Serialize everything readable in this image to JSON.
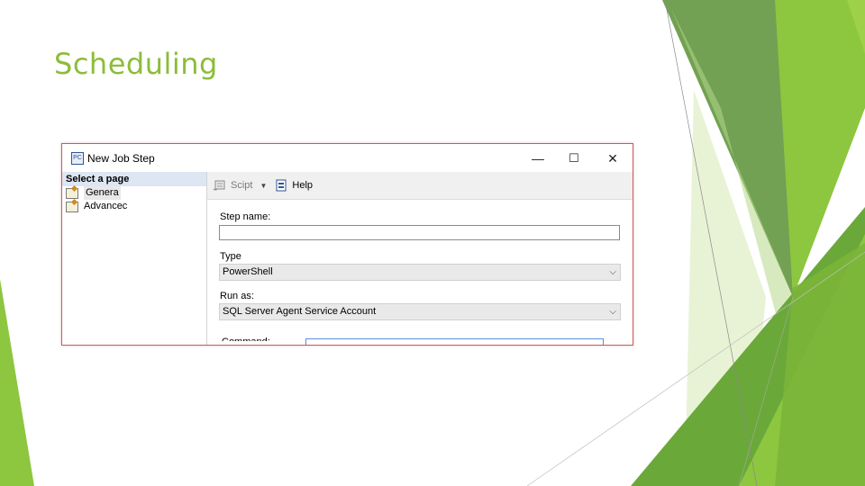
{
  "slide": {
    "title": "Scheduling"
  },
  "colors": {
    "title": "#8cbd3a",
    "accent_green": "#8dc63f",
    "dark_green": "#5a9a2e",
    "light_green": "#d4e9a5"
  },
  "dialog": {
    "title": "New Job Step",
    "app_icon": "PC",
    "window_buttons": {
      "minimize": "—",
      "maximize": "☐",
      "close": "✕"
    },
    "left_pane": {
      "header": "Select a page",
      "items": [
        {
          "label": "Genera",
          "icon": "page-settings-icon",
          "selected": true
        },
        {
          "label": "Advancec",
          "icon": "page-settings-icon",
          "selected": false
        }
      ]
    },
    "toolbar": {
      "script_label": "Scipt",
      "script_icon": "script-icon",
      "dropdown_icon": "chevron-down-icon",
      "help_label": "Help",
      "help_icon": "help-icon"
    },
    "form": {
      "step_name_label": "Step name:",
      "step_name_value": "",
      "type_label": "Type",
      "type_value": "PowerShell",
      "run_as_label": "Run as:",
      "run_as_value": "SQL Server Agent Service Account",
      "command_label": "Command:"
    }
  }
}
